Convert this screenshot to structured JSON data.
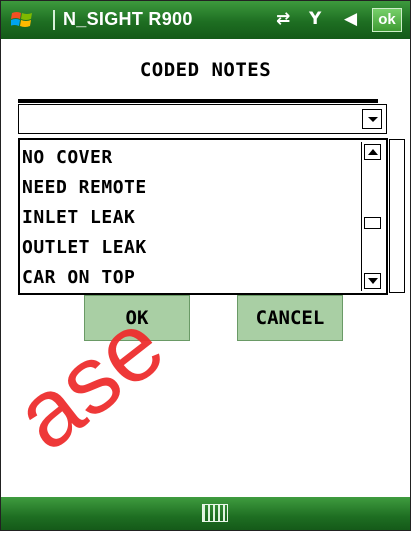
{
  "statusbar": {
    "app_title": "N_SIGHT R900",
    "icons": [
      "windows-start-icon",
      "connectivity-icon",
      "signal-off-icon",
      "speaker-icon"
    ],
    "ok_label": "ok"
  },
  "main": {
    "title": "CODED NOTES",
    "combo_value": "",
    "dropdown_items": [
      "NO COVER",
      "NEED REMOTE",
      "INLET LEAK",
      "OUTLET LEAK",
      "CAR ON TOP"
    ],
    "ok_button": "OK",
    "cancel_button": "CANCEL"
  },
  "bottombar": {
    "icon": "keyboard-icon"
  },
  "watermark": "ase",
  "colors": {
    "bar_green": "#1e6e22",
    "button_green": "#a9cfa4",
    "watermark_red": "#ee2e2e"
  }
}
